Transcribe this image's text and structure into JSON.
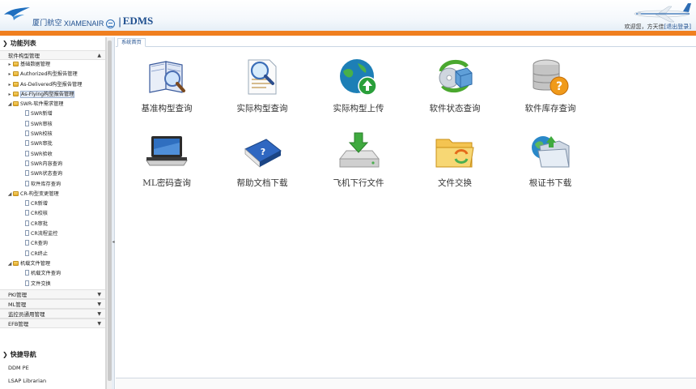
{
  "header": {
    "brand_cn": "厦门航空",
    "brand_en": "XIAMENAIR",
    "separator": "|",
    "system_name": "EDMS",
    "welcome_prefix": "欢迎您，",
    "user_name": "方天佳",
    "logout_label": "[退出登录]"
  },
  "sidebar": {
    "title": "功能列表",
    "active_group": "软件构型管理",
    "tree": [
      {
        "label": "基础数据管理",
        "type": "folder",
        "level": 1,
        "expander": "▸"
      },
      {
        "label": "Authorized构型报告管理",
        "type": "folder",
        "level": 1,
        "expander": "▸"
      },
      {
        "label": "As-Delivered构型报告管理",
        "type": "folder",
        "level": 1,
        "expander": "▸"
      },
      {
        "label": "As-Flying构型报告管理",
        "type": "folder",
        "level": 1,
        "expander": "▸",
        "selected": true
      },
      {
        "label": "SWR-软件需求管理",
        "type": "folder",
        "level": 1,
        "expander": "◢"
      },
      {
        "label": "SWR新增",
        "type": "page",
        "level": 2
      },
      {
        "label": "SWR审核",
        "type": "page",
        "level": 2
      },
      {
        "label": "SWR校核",
        "type": "page",
        "level": 2
      },
      {
        "label": "SWR审批",
        "type": "page",
        "level": 2
      },
      {
        "label": "SWR验收",
        "type": "page",
        "level": 2
      },
      {
        "label": "SWR内容查询",
        "type": "page",
        "level": 2
      },
      {
        "label": "SWR状态查询",
        "type": "page",
        "level": 2
      },
      {
        "label": "软件库存查询",
        "type": "page",
        "level": 2
      },
      {
        "label": "CR-构型变更管理",
        "type": "folder",
        "level": 1,
        "expander": "◢"
      },
      {
        "label": "CR新增",
        "type": "page",
        "level": 2
      },
      {
        "label": "CR校核",
        "type": "page",
        "level": 2
      },
      {
        "label": "CR审批",
        "type": "page",
        "level": 2
      },
      {
        "label": "CR流程监控",
        "type": "page",
        "level": 2
      },
      {
        "label": "CR查询",
        "type": "page",
        "level": 2
      },
      {
        "label": "CR终止",
        "type": "page",
        "level": 2
      },
      {
        "label": "机载文件管理",
        "type": "folder",
        "level": 1,
        "expander": "◢"
      },
      {
        "label": "机载文件查询",
        "type": "page",
        "level": 2
      },
      {
        "label": "文件交换",
        "type": "page",
        "level": 2
      }
    ],
    "groups": [
      "PKI管理",
      "ML管理",
      "监控员通用管理",
      "EFB管理"
    ],
    "quick_title": "快捷导航",
    "quick_items": [
      "DDM PE",
      "LSAP Librarian"
    ]
  },
  "main": {
    "tab_label": "系统首页",
    "tiles": [
      {
        "label": "基准构型查询",
        "icon": "book-magnifier-icon"
      },
      {
        "label": "实际构型查询",
        "icon": "document-magnifier-icon"
      },
      {
        "label": "实际构型上传",
        "icon": "globe-upload-icon"
      },
      {
        "label": "软件状态查询",
        "icon": "disc-box-refresh-icon"
      },
      {
        "label": "软件库存查询",
        "icon": "database-question-icon"
      },
      {
        "label": "ML密码查询",
        "icon": "laptop-icon"
      },
      {
        "label": "帮助文档下载",
        "icon": "help-book-icon"
      },
      {
        "label": "飞机下行文件",
        "icon": "drive-download-icon"
      },
      {
        "label": "文件交换",
        "icon": "folder-exchange-icon"
      },
      {
        "label": "根证书下载",
        "icon": "folder-globe-icon"
      }
    ]
  },
  "colors": {
    "accent_orange": "#f07f1f",
    "brand_blue": "#1f4f8f"
  }
}
